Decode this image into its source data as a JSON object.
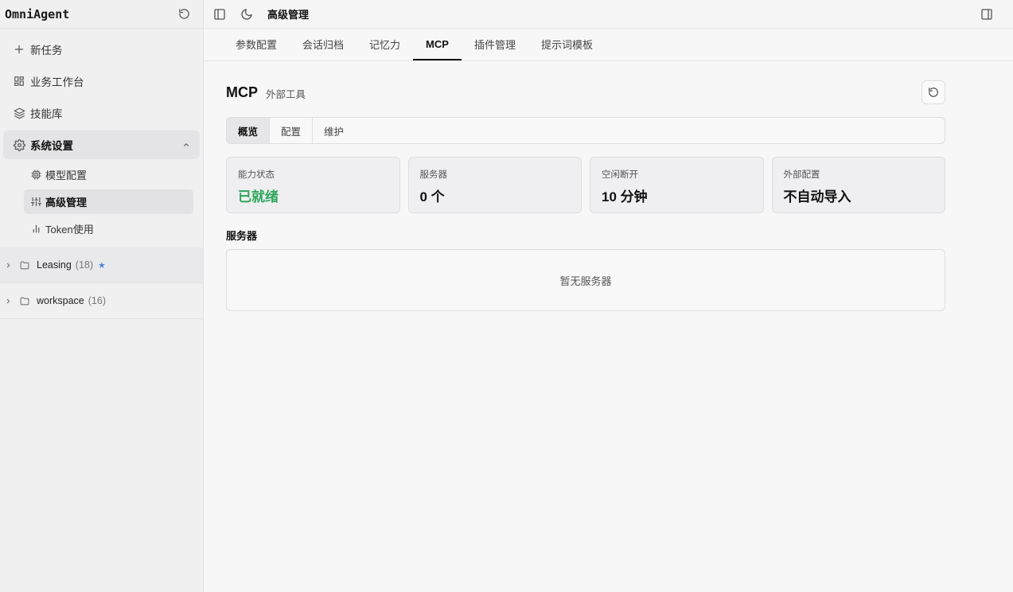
{
  "app": {
    "brand": "OmniAgent"
  },
  "sidebar": {
    "nav": [
      {
        "label": "新任务",
        "icon": "plus-icon"
      },
      {
        "label": "业务工作台",
        "icon": "grid-icon"
      },
      {
        "label": "技能库",
        "icon": "layers-icon"
      },
      {
        "label": "系统设置",
        "icon": "gear-icon",
        "expanded": true
      }
    ],
    "settings_sub": [
      {
        "label": "模型配置",
        "icon": "chip-icon"
      },
      {
        "label": "高级管理",
        "icon": "sliders-icon",
        "active": true
      },
      {
        "label": "Token使用",
        "icon": "bar-chart-icon"
      }
    ],
    "folders": [
      {
        "name": "Leasing",
        "count": "(18)",
        "starred": "★"
      },
      {
        "name": "workspace",
        "count": "(16)"
      }
    ]
  },
  "topbar": {
    "title": "高级管理"
  },
  "tabs": [
    {
      "label": "参数配置"
    },
    {
      "label": "会话归档"
    },
    {
      "label": "记忆力"
    },
    {
      "label": "MCP",
      "active": true
    },
    {
      "label": "插件管理"
    },
    {
      "label": "提示词模板"
    }
  ],
  "page": {
    "title": "MCP",
    "subtitle": "外部工具",
    "segments": [
      {
        "label": "概览",
        "active": true
      },
      {
        "label": "配置"
      },
      {
        "label": "维护"
      }
    ],
    "stats": [
      {
        "label": "能力状态",
        "value": "已就绪",
        "status_color": "#2ea65a"
      },
      {
        "label": "服务器",
        "value": "0 个"
      },
      {
        "label": "空闲断开",
        "value": "10 分钟"
      },
      {
        "label": "外部配置",
        "value": "不自动导入"
      }
    ],
    "servers_title": "服务器",
    "servers_empty": "暂无服务器"
  }
}
